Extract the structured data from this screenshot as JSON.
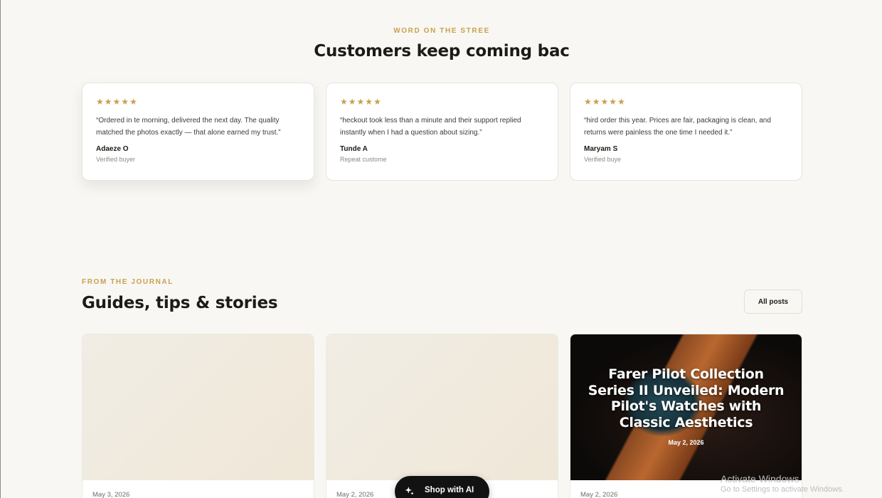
{
  "testimonials": {
    "eyebrow": "WORD ON THE STREE",
    "title": "Customers keep coming bac",
    "rating_icon": "star-icon",
    "reviews": [
      {
        "stars": 5,
        "quote": "“Ordered in te morning, delivered the next day. The quality matched the photos exactly — that alone earned my trust.”",
        "author": "Adaeze O",
        "role": "Verified buyer"
      },
      {
        "stars": 5,
        "quote": "“heckout took less than a minute and their support replied instantly when I had a question about sizing.”",
        "author": "Tunde A",
        "role": "Repeat custome"
      },
      {
        "stars": 5,
        "quote": "“hird order this year. Prices are fair, packaging is clean, and returns were painless the one time I needed it.”",
        "author": "Maryam S",
        "role": "Verified buye"
      }
    ]
  },
  "journal": {
    "eyebrow": "FROM THE JOURNAL",
    "title": "Guides, tips & stories",
    "all_posts_label": "All posts",
    "posts": [
      {
        "date": "May 3, 2026"
      },
      {
        "date": "May 2, 2026"
      },
      {
        "date": "May 2, 2026",
        "image_title": "Farer Pilot Collection Series II Unveiled: Modern Pilot's Watches with Classic Aesthetics",
        "image_date": "May 2, 2026"
      }
    ]
  },
  "shop_ai": {
    "label": "Shop with AI",
    "icon": "sparkle-icon"
  },
  "os_watermark": {
    "line1": "Activate Windows",
    "line2": "Go to Settings to activate Windows."
  },
  "colors": {
    "accent": "#c8a14f",
    "background": "#f8f7f3",
    "dark": "#121212"
  }
}
